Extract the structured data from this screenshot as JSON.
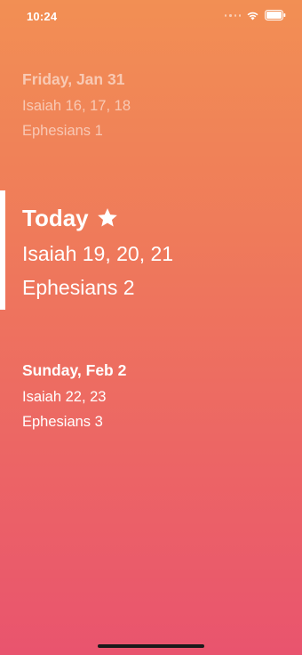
{
  "status_bar": {
    "time": "10:24"
  },
  "days": {
    "previous": {
      "title": "Friday, Jan 31",
      "readings": [
        "Isaiah 16, 17, 18",
        "Ephesians 1"
      ]
    },
    "today": {
      "title": "Today",
      "icon": "star-icon",
      "readings": [
        "Isaiah 19, 20, 21",
        "Ephesians 2"
      ]
    },
    "next": {
      "title": "Sunday, Feb 2",
      "readings": [
        "Isaiah 22, 23",
        "Ephesians 3"
      ]
    }
  },
  "colors": {
    "gradient_top": "#f28f54",
    "gradient_bottom": "#e9546e",
    "text": "#ffffff"
  }
}
